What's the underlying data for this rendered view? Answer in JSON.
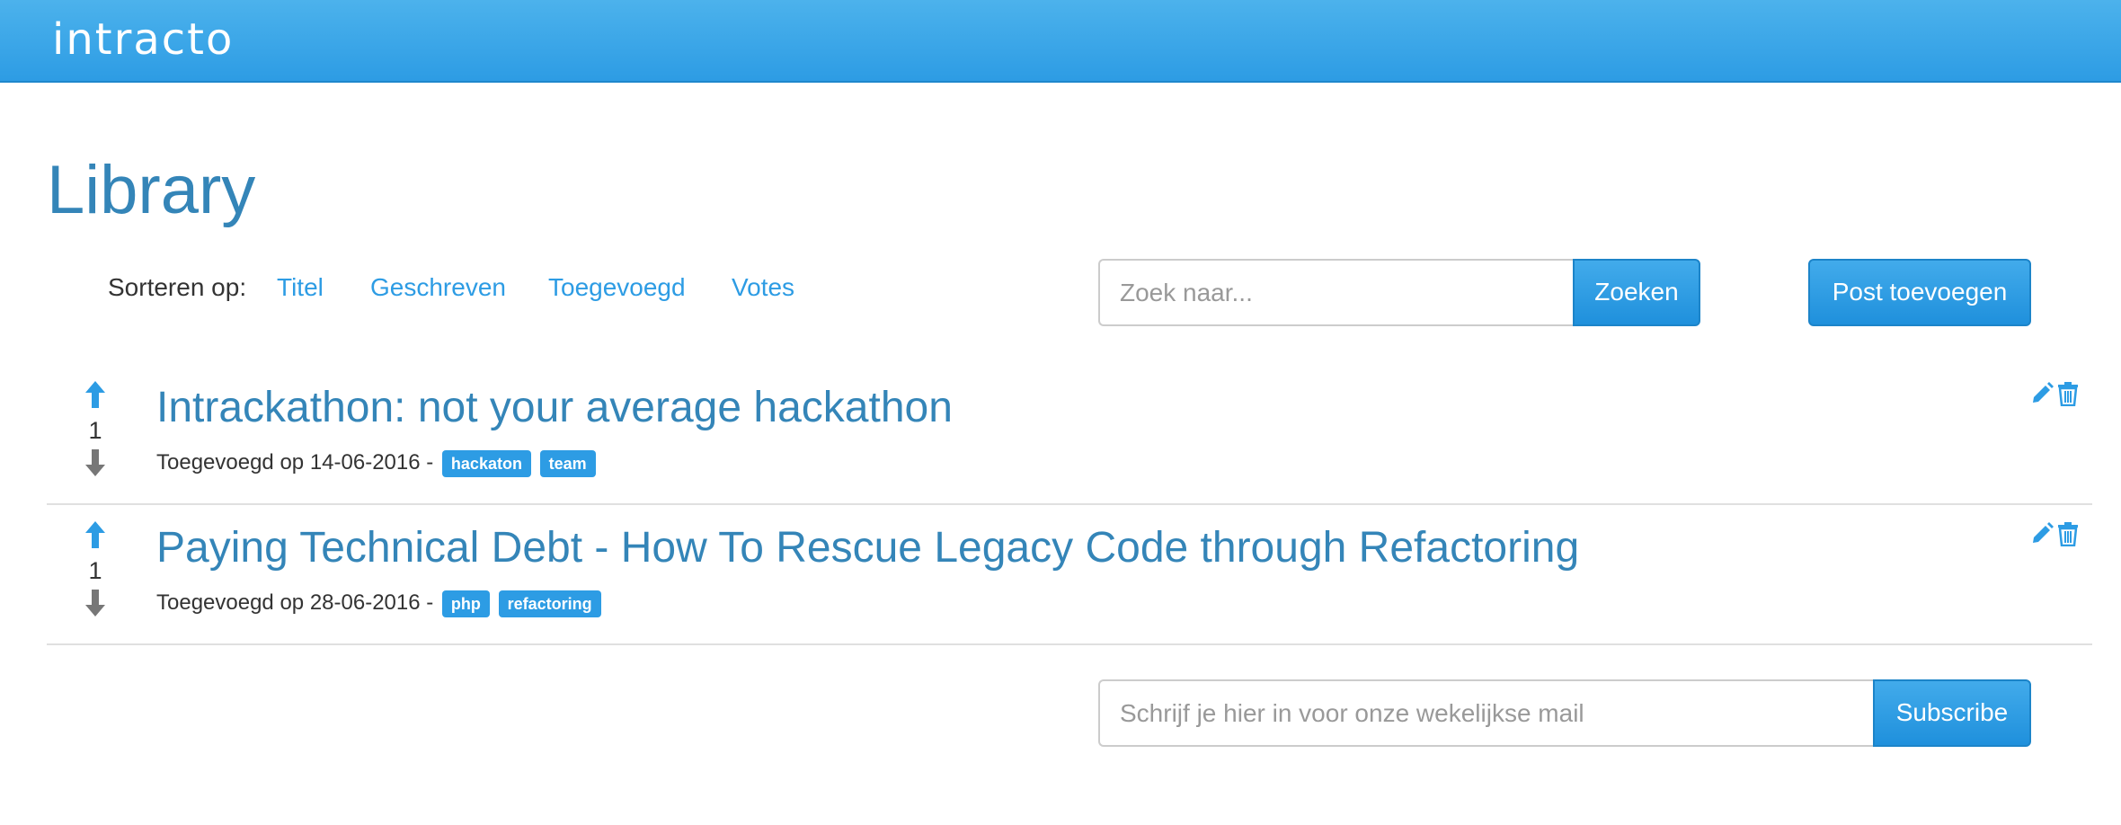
{
  "header": {
    "brand": "intracto",
    "brand_color": "#2d9ce4"
  },
  "page": {
    "title": "Library"
  },
  "sort": {
    "label": "Sorteren op:",
    "options": [
      "Titel",
      "Geschreven",
      "Toegevoegd",
      "Votes"
    ]
  },
  "search": {
    "placeholder": "Zoek naar...",
    "value": "",
    "button_label": "Zoeken"
  },
  "add_post": {
    "label": "Post toevoegen"
  },
  "posts": [
    {
      "votes": "1",
      "title": "Intrackathon: not your average hackathon",
      "meta": "Toegevoegd op 14-06-2016 -",
      "tags": [
        "hackaton",
        "team"
      ]
    },
    {
      "votes": "1",
      "title": "Paying Technical Debt - How To Rescue Legacy Code through Refactoring",
      "meta": "Toegevoegd op 28-06-2016 -",
      "tags": [
        "php",
        "refactoring"
      ]
    }
  ],
  "icons": {
    "vote_up": "arrow-up-icon",
    "vote_down": "arrow-down-icon",
    "edit": "pencil-icon",
    "delete": "trash-icon"
  },
  "newsletter": {
    "placeholder": "Schrijf je hier in voor onze wekelijkse mail",
    "value": "",
    "button_label": "Subscribe"
  },
  "colors": {
    "accent": "#2d9ce4",
    "title": "#3485b8",
    "vote_down": "#777777",
    "text": "#333333"
  }
}
